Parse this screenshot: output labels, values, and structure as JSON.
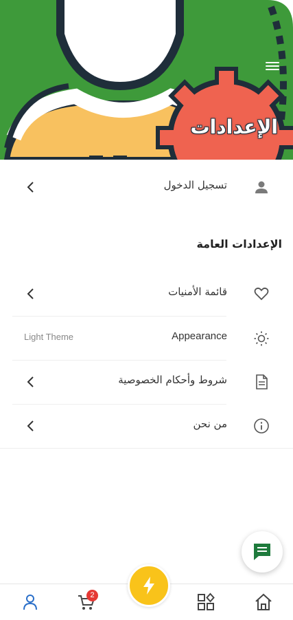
{
  "header": {
    "title": "الإعدادات"
  },
  "account": {
    "login_label": "تسجيل الدخول"
  },
  "general": {
    "section_title": "الإعدادات العامة",
    "items": [
      {
        "label": "قائمة الأمنيات",
        "icon": "heart-icon"
      },
      {
        "label": "Appearance",
        "value": "Light Theme",
        "icon": "sun-icon"
      },
      {
        "label": "شروط وأحكام الخصوصية",
        "icon": "document-icon"
      },
      {
        "label": "من نحن",
        "icon": "info-icon"
      }
    ]
  },
  "bottom_nav": {
    "cart_badge": "2"
  },
  "colors": {
    "header_green": "#3e9a3a",
    "gear_red": "#ef6350",
    "body_yellow": "#f8c15f",
    "outline_navy": "#1f2e3a",
    "flash_yellow": "#f9c31a",
    "chat_green": "#1e7a3c",
    "badge_red": "#e53935",
    "user_blue": "#2a6fc9"
  }
}
